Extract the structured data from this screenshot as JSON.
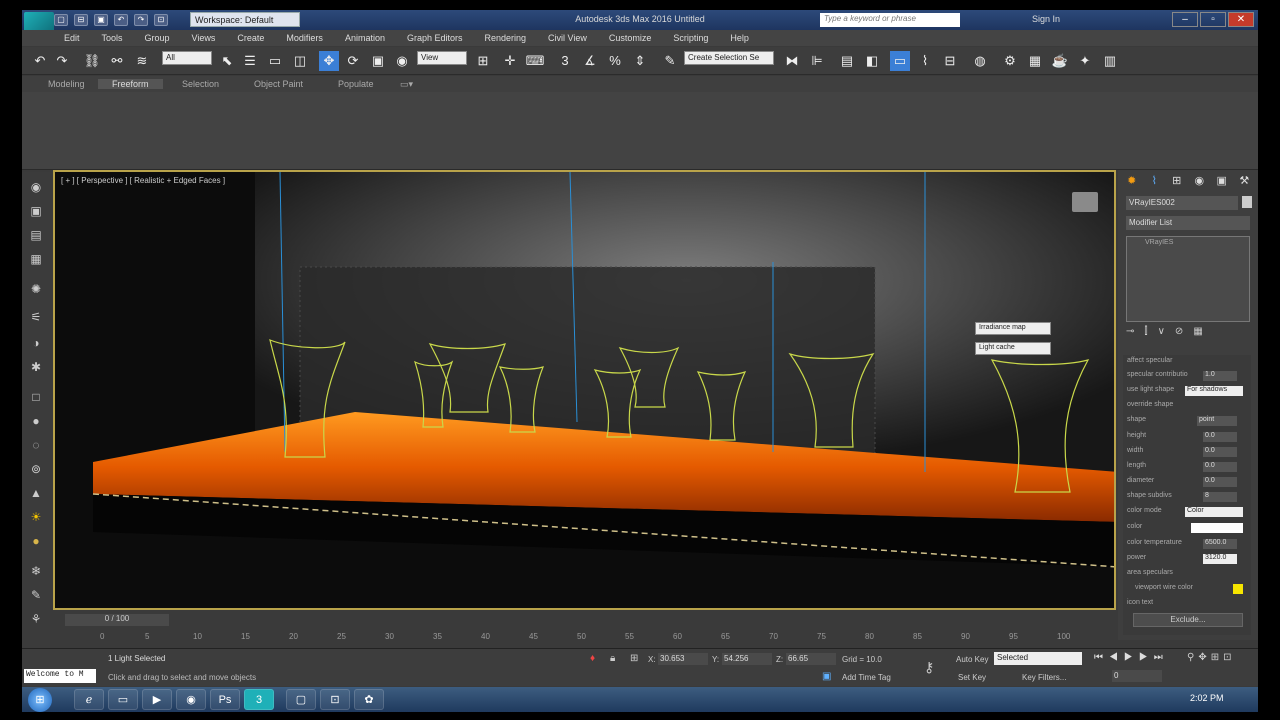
{
  "app": {
    "title": "Autodesk 3ds Max 2016    Untitled",
    "logo": "MAX",
    "workspace": "Workspace: Default",
    "search_placeholder": "Type a keyword or phrase",
    "sign_in": "Sign In"
  },
  "menu": [
    "Edit",
    "Tools",
    "Group",
    "Views",
    "Create",
    "Modifiers",
    "Animation",
    "Graph Editors",
    "Rendering",
    "Civil View",
    "Customize",
    "Scripting",
    "Help"
  ],
  "toolbar": {
    "filter": "All",
    "ref_coord": "View",
    "named_selection": "Create Selection Se"
  },
  "ribbon_tabs": [
    "Modeling",
    "Freeform",
    "Selection",
    "Object Paint",
    "Populate"
  ],
  "ribbon_active": "Freeform",
  "viewport": {
    "label": "[ + ] [ Perspective ] [ Realistic + Edged Faces ]",
    "dropdown1": "Irradiance map",
    "dropdown2": "Light cache"
  },
  "command_panel": {
    "object_name": "VRayIES002",
    "modifier_list": "Modifier List",
    "stack_item": "VRayIES"
  },
  "params": [
    {
      "label": "affect specular",
      "value": ""
    },
    {
      "label": "specular contributio",
      "value": "1.0"
    },
    {
      "label": "use light shape",
      "value": "For shadows"
    },
    {
      "label": "override shape",
      "value": ""
    },
    {
      "label": "shape",
      "value": "point"
    },
    {
      "label": "height",
      "value": "0.0"
    },
    {
      "label": "width",
      "value": "0.0"
    },
    {
      "label": "length",
      "value": "0.0"
    },
    {
      "label": "diameter",
      "value": "0.0"
    },
    {
      "label": "shape subdivs",
      "value": "8"
    },
    {
      "label": "color mode",
      "value": "Color"
    },
    {
      "label": "color",
      "value": ""
    },
    {
      "label": "color temperature",
      "value": "6500.0"
    },
    {
      "label": "power",
      "value": "3120.0"
    },
    {
      "label": "area speculars",
      "value": ""
    },
    {
      "label": "viewport wire color",
      "value": ""
    },
    {
      "label": "icon text",
      "value": ""
    }
  ],
  "exclude_label": "Exclude...",
  "timeline": {
    "frame": "0 / 100",
    "ticks": [
      "0",
      "5",
      "10",
      "15",
      "20",
      "25",
      "30",
      "35",
      "40",
      "45",
      "50",
      "55",
      "60",
      "65",
      "70",
      "75",
      "80",
      "85",
      "90",
      "95",
      "100"
    ]
  },
  "status": {
    "welcome": "Welcome to M",
    "selected": "1 Light Selected",
    "prompt": "Click and drag to select and move objects",
    "x_label": "X:",
    "x": "30.653",
    "y_label": "Y:",
    "y": "54.256",
    "z_label": "Z:",
    "z": "66.65",
    "grid": "Grid = 10.0",
    "add_time_tag": "Add Time Tag",
    "auto_key": "Auto Key",
    "set_key": "Set Key",
    "key_mode": "Selected",
    "key_filters": "Key Filters...",
    "frame_field": "0"
  },
  "taskbar": {
    "time": "2:02 PM"
  },
  "colors": {
    "wire_color": "#f6e500",
    "floor_glow": "#ff6a00",
    "vase_wire": "#c9d84a",
    "selection_border": "#b9a34a"
  }
}
